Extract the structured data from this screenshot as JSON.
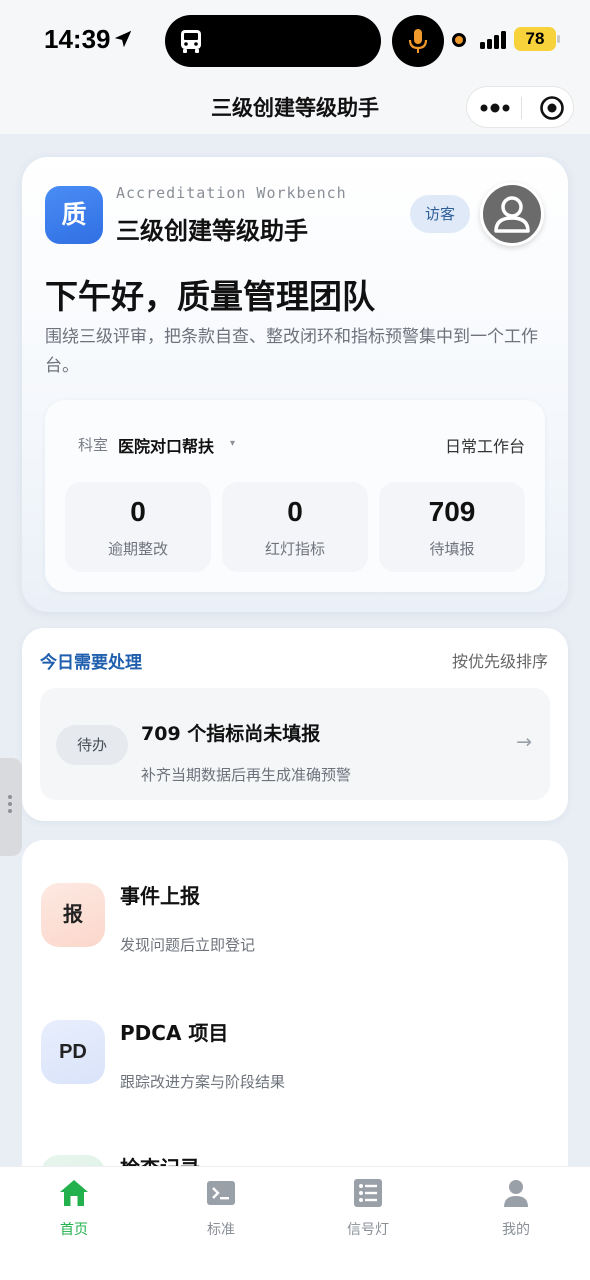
{
  "status_bar": {
    "time": "14:39",
    "battery": "78",
    "icons": [
      "location-arrow-icon",
      "bus-icon",
      "microphone-icon",
      "recording-dot-icon",
      "signal-icon",
      "battery-icon"
    ]
  },
  "nav": {
    "title": "三级创建等级助手",
    "icons": [
      "more-dots-icon",
      "close-target-icon"
    ]
  },
  "hero": {
    "logo_char": "质",
    "subtitle": "Accreditation Workbench",
    "app_title": "三级创建等级助手",
    "guest_label": "访客",
    "greeting": "下午好，质量管理团队",
    "intro": "围绕三级评审，把条款自查、整改闭环和指标预警集中到一个工作台。",
    "dept_label": "科室",
    "dept_value": "医院对口帮扶",
    "dept_caret": "▾",
    "workbench_label": "日常工作台",
    "stats": [
      {
        "value": "0",
        "label": "逾期整改"
      },
      {
        "value": "0",
        "label": "红灯指标"
      },
      {
        "value": "709",
        "label": "待填报"
      }
    ]
  },
  "today": {
    "title": "今日需要处理",
    "sort_label": "按优先级排序",
    "task": {
      "badge": "待办",
      "title": "709 个指标尚未填报",
      "desc": "补齐当期数据后再生成准确预警",
      "arrow": "→"
    }
  },
  "actions": [
    {
      "icon_text": "报",
      "title": "事件上报",
      "desc": "发现问题后立即登记",
      "color": "#fde3da"
    },
    {
      "icon_text": "PD",
      "title": "PDCA 项目",
      "desc": "跟踪改进方案与阶段结果",
      "color": "#e3ebfb"
    },
    {
      "icon_text": "",
      "title": "检查记录",
      "desc": "",
      "color": "#e3f4ea"
    }
  ],
  "tabs": [
    {
      "label": "首页",
      "icon": "home-icon",
      "active": true
    },
    {
      "label": "标准",
      "icon": "terminal-icon",
      "active": false
    },
    {
      "label": "信号灯",
      "icon": "list-icon",
      "active": false
    },
    {
      "label": "我的",
      "icon": "user-icon",
      "active": false
    }
  ],
  "colors": {
    "accent_green": "#22b14c",
    "accent_blue": "#1f5fae",
    "battery": "#f7d23a"
  }
}
